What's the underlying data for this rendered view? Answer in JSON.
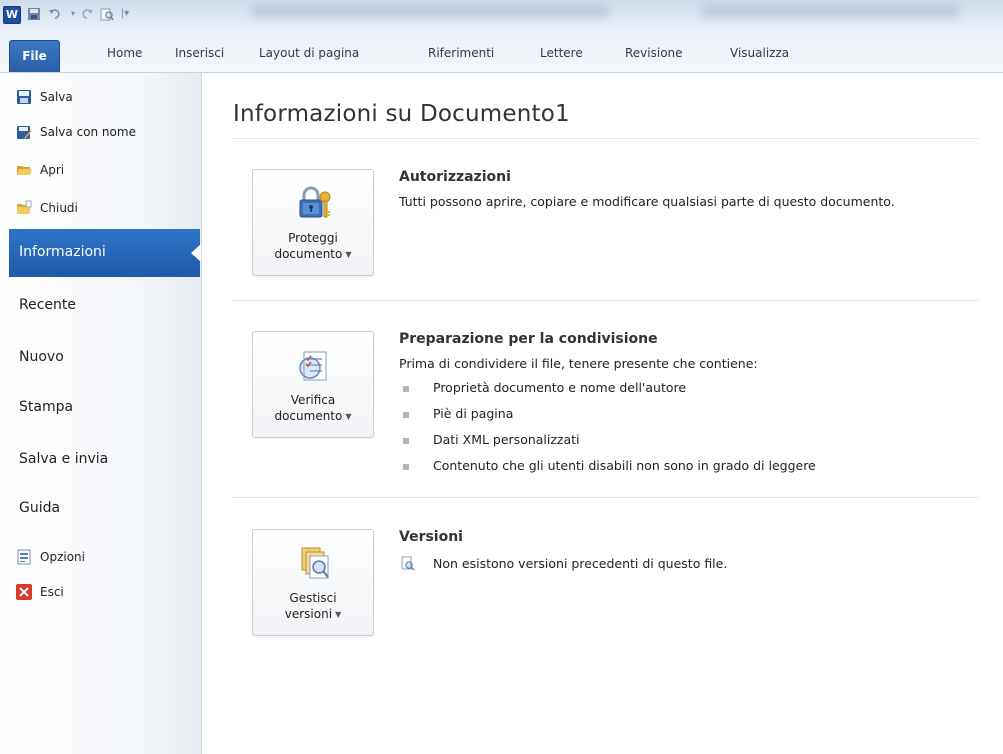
{
  "ribbon": {
    "file_tab": "File",
    "tabs": [
      "Home",
      "Inserisci",
      "Layout di pagina",
      "Riferimenti",
      "Lettere",
      "Revisione",
      "Visualizza"
    ]
  },
  "quick_access": {
    "logo_letter": "W",
    "icons": [
      "save-icon",
      "undo-icon",
      "redo-icon",
      "print-preview-icon"
    ]
  },
  "sidebar": {
    "commands": [
      {
        "label": "Salva",
        "icon": "save-icon"
      },
      {
        "label": "Salva con nome",
        "icon": "save-as-icon"
      },
      {
        "label": "Apri",
        "icon": "open-folder-icon"
      },
      {
        "label": "Chiudi",
        "icon": "close-folder-icon"
      }
    ],
    "active": "Informazioni",
    "nav": [
      "Recente",
      "Nuovo",
      "Stampa",
      "Salva e invia",
      "Guida"
    ],
    "bottom": [
      {
        "label": "Opzioni",
        "icon": "options-icon"
      },
      {
        "label": "Esci",
        "icon": "exit-icon"
      }
    ]
  },
  "main": {
    "title": "Informazioni su Documento1",
    "sections": [
      {
        "button_line1": "Proteggi",
        "button_line2": "documento",
        "heading": "Autorizzazioni",
        "text": "Tutti possono aprire, copiare e modificare qualsiasi parte di questo documento."
      },
      {
        "button_line1": "Verifica",
        "button_line2": "documento",
        "heading": "Preparazione per la condivisione",
        "text": "Prima di condividere il file, tenere presente che contiene:",
        "items": [
          "Proprietà documento e nome dell'autore",
          "Piè di pagina",
          "Dati XML personalizzati",
          "Contenuto che gli utenti disabili non sono in grado di leggere"
        ]
      },
      {
        "button_line1": "Gestisci",
        "button_line2": "versioni",
        "heading": "Versioni",
        "text": "Non esistono versioni precedenti di questo file."
      }
    ]
  },
  "colors": {
    "accent": "#2a67b8",
    "file_tab": "#2f6bb8",
    "sidebar_bg": "#f3f6fa"
  }
}
